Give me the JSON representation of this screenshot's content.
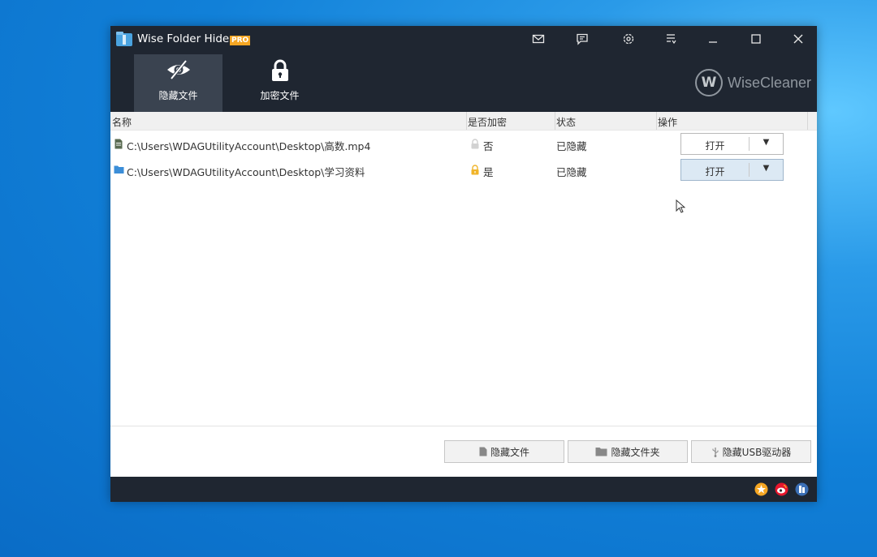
{
  "window": {
    "app_name": "Wise Folder Hider",
    "pro_badge": "PRO",
    "brand": "WiseCleaner",
    "brand_mark": "W"
  },
  "title_icons": [
    "mail-icon",
    "feedback-icon",
    "settings-icon",
    "menu-icon"
  ],
  "nav": {
    "hide_files": "隐藏文件",
    "encrypt_files": "加密文件"
  },
  "table": {
    "columns": [
      "名称",
      "是否加密",
      "状态",
      "操作"
    ],
    "rows": [
      {
        "type": "file",
        "path": "C:\\Users\\WDAGUtilityAccount\\Desktop\\高数.mp4",
        "encrypted": "否",
        "status": "已隐藏",
        "action": "打开",
        "dropdown": "▼"
      },
      {
        "type": "folder",
        "path": "C:\\Users\\WDAGUtilityAccount\\Desktop\\学习资料",
        "encrypted": "是",
        "status": "已隐藏",
        "action": "打开",
        "dropdown": "▼"
      }
    ]
  },
  "bottom_buttons": {
    "hide_file": "隐藏文件",
    "hide_folder": "隐藏文件夹",
    "hide_usb": "隐藏USB驱动器"
  },
  "status_icons": [
    "star-icon",
    "weibo-icon",
    "social-icon"
  ],
  "colors": {
    "titlebar": "#1f2631",
    "active_tab": "#3a4350",
    "pro": "#f5a623",
    "folder_blue": "#3b8ed8",
    "lock_gold": "#f0b429"
  }
}
